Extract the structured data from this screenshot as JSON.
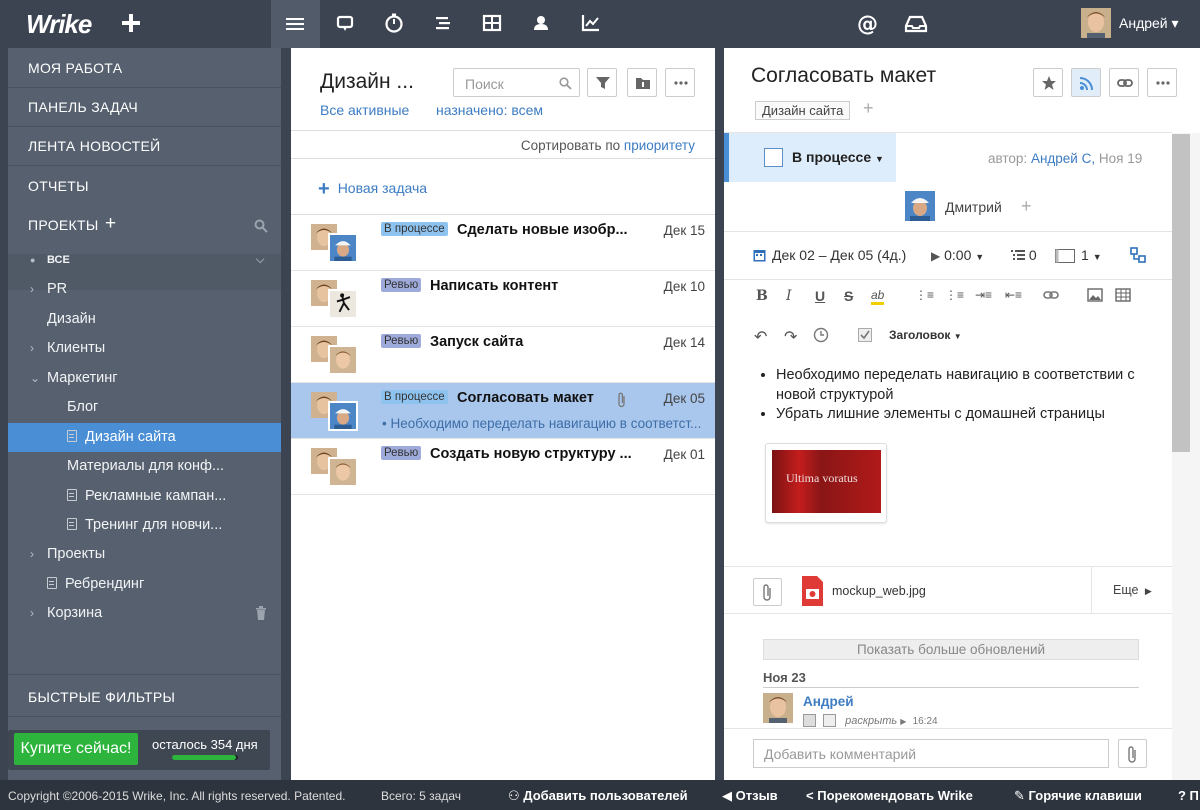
{
  "topbar": {
    "logo": "Wrike",
    "user_name": "Андрей",
    "icons": [
      "plus-icon",
      "menu-icon",
      "stream-icon",
      "timer-icon",
      "timeline-icon",
      "table-icon",
      "user-icon",
      "chart-icon",
      "mention-icon",
      "inbox-icon"
    ]
  },
  "sidebar": {
    "my_work": "МОЯ РАБОТА",
    "dashboard": "ПАНЕЛЬ ЗАДАЧ",
    "news": "ЛЕНТА НОВОСТЕЙ",
    "reports": "ОТЧЕТЫ",
    "projects": "ПРОЕКТЫ",
    "tree": [
      {
        "label": "ВСЕ"
      },
      {
        "label": "PR"
      },
      {
        "label": "Дизайн"
      },
      {
        "label": "Клиенты"
      },
      {
        "label": "Маркетинг"
      },
      {
        "label": "Блог"
      },
      {
        "label": "Дизайн сайта"
      },
      {
        "label": "Материалы для конф..."
      },
      {
        "label": "Рекламные кампан..."
      },
      {
        "label": "Тренинг для новчи..."
      },
      {
        "label": "Проекты"
      },
      {
        "label": "Ребрендинг"
      },
      {
        "label": "Корзина"
      }
    ],
    "quick_filters": "БЫСТРЫЕ ФИЛЬТРЫ",
    "buy_now": "Купите сейчас!",
    "days_left": "осталось 354 дня",
    "trial_progress": 0.97
  },
  "list": {
    "title": "Дизайн ...",
    "search_placeholder": "Поиск",
    "filter_active": "Все активные",
    "filter_assigned": "назначено: всем",
    "sort_prefix": "Сортировать по",
    "sort_value": "приоритету",
    "new_task": "Новая задача",
    "tasks": [
      {
        "status": "В процессе",
        "name": "Сделать новые изобр...",
        "date": "Дек 15"
      },
      {
        "status": "Ревью",
        "name": "Написать контент",
        "date": "Дек 10"
      },
      {
        "status": "Ревью",
        "name": "Запуск сайта",
        "date": "Дек 14"
      },
      {
        "status": "В процессе",
        "name": "Согласовать макет",
        "date": "Дек 05",
        "subtitle": "• Необходимо переделать навигацию в соответст..."
      },
      {
        "status": "Ревью",
        "name": "Создать новую структуру ...",
        "date": "Дек 01"
      }
    ]
  },
  "detail": {
    "title": "Согласовать макет",
    "tag": "Дизайн сайта",
    "status": "В процессе",
    "author_prefix": "автор:",
    "author": "Андрей С,",
    "created": "Ноя 19",
    "assignee": "Дмитрий",
    "dates": "Дек 02 – Дек 05 (4д.)",
    "time": "0:00",
    "subtasks": "0",
    "importance": "1",
    "heading_style": "Заголовок",
    "bullets": [
      "Необходимо переделать навигацию в соответствии с новой структурой",
      "Убрать лишние элементы с домашней страницы"
    ],
    "image_caption": "Ultima voratus",
    "attachment": "mockup_web.jpg",
    "more": "Еще",
    "show_more": "Показать больше обновлений",
    "date_header": "Ноя 23",
    "comment_author": "Андрей",
    "comment_action": "раскрыть",
    "comment_time": "16:24",
    "comment_placeholder": "Добавить комментарий"
  },
  "footer": {
    "copyright": "Copyright ©2006-2015 Wrike, Inc. All rights reserved. Patented.",
    "total": "Всего: 5 задач",
    "add_users": "Добавить пользователей",
    "feedback": "Отзыв",
    "recommend": "Порекомендовать Wrike",
    "hotkeys": "Горячие клавиши",
    "help": "? П"
  },
  "colors": {
    "accent": "#4a8fd6",
    "buy": "#2db43c",
    "sidebar": "#56606e",
    "topbar": "#3c4452"
  }
}
